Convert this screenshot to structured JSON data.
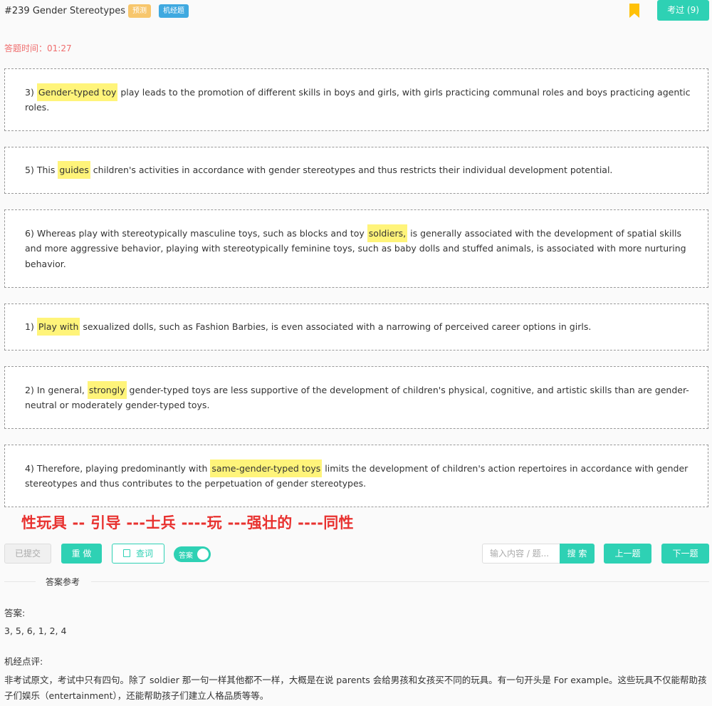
{
  "header": {
    "title": "#239 Gender Stereotypes",
    "badge_predict": "预测",
    "badge_jijing": "机经题",
    "pass_button": "考过 (9)",
    "bookmark_color": "#ffc107"
  },
  "timer": "答题时间：01:27",
  "paragraphs": [
    {
      "num": "3)",
      "pre": "",
      "hl": "Gender-typed toy",
      "post": " play leads to the promotion of different skills in boys and girls, with girls practicing communal roles and boys practicing agentic roles."
    },
    {
      "num": "5)",
      "pre": "This ",
      "hl": "guides",
      "post": " children's activities in accordance with gender stereotypes and thus restricts their individual development potential."
    },
    {
      "num": "6)",
      "pre": "Whereas play with stereotypically masculine toys, such as blocks and toy ",
      "hl": "soldiers,",
      "post": " is generally associated with the development of spatial skills and more aggressive behavior, playing with stereotypically feminine toys, such as baby dolls and stuffed animals, is associated with more nurturing behavior."
    },
    {
      "num": "1)",
      "pre": "",
      "hl": "Play with",
      "post": " sexualized dolls, such as Fashion Barbies, is even associated with a narrowing of perceived career options in girls."
    },
    {
      "num": "2)",
      "pre": "In general, ",
      "hl": "strongly",
      "post": " gender-typed toys are less supportive of the development of children's physical, cognitive, and artistic skills than are gender-neutral or moderately gender-typed toys."
    },
    {
      "num": "4)",
      "pre": "Therefore, playing predominantly with ",
      "hl": "same-gender-typed toys",
      "post": " limits the development of children's action repertoires in accordance with gender stereotypes and thus contributes to the perpetuation of gender stereotypes."
    }
  ],
  "note": "性玩具 -- 引导 ---士兵 ----玩 ---强壮的 ----同性",
  "toolbar": {
    "submitted": "已提交",
    "redo": "重 做",
    "lookup": "查词",
    "toggle_label": "答案",
    "search_placeholder": "输入内容 / 题...",
    "search": "搜 索",
    "prev": "上一题",
    "next": "下一题"
  },
  "answer_section": {
    "divider": "答案参考",
    "answer_label": "答案:",
    "answer_value": "3, 5, 6, 1, 2, 4",
    "comment_label": "机经点评:",
    "comment_text": "非考试原文，考试中只有四句。除了 soldier 那一句一样其他都不一样，大概是在说 parents 会给男孩和女孩买不同的玩具。有一句开头是 For example。这些玩具不仅能帮助孩子们娱乐（entertainment），还能帮助孩子们建立人格品质等等。"
  }
}
